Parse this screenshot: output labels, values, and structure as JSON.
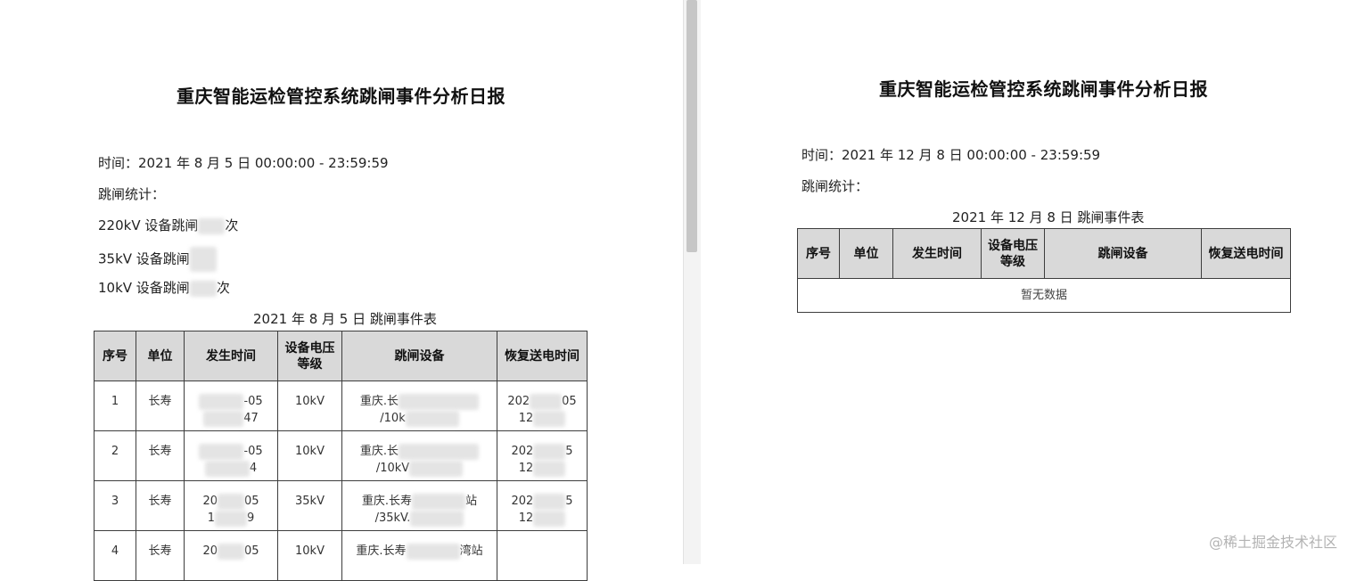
{
  "left": {
    "title": "重庆智能运检管控系统跳闸事件分析日报",
    "time_line": "时间：2021 年 8 月 5 日 00:00:00 - 23:59:59",
    "stats_heading": "跳闸统计：",
    "stats": [
      "220kV 设备跳闸",
      "35kV 设备跳闸",
      "10kV 设备跳闸"
    ],
    "stats_suffix": [
      "次",
      "",
      "次"
    ],
    "table_caption": "2021 年 8 月 5 日 跳闸事件表",
    "headers": [
      "序号",
      "单位",
      "发生时间",
      "设备电压等级",
      "跳闸设备",
      "恢复送电时间"
    ],
    "rows": [
      {
        "no": "1",
        "unit": "长寿",
        "time_a": "-05",
        "time_b": "47",
        "voltage": "10kV",
        "device_a": "重庆.长",
        "device_b": "/10k",
        "restore_a": "202",
        "restore_a2": "05",
        "restore_b": "12"
      },
      {
        "no": "2",
        "unit": "长寿",
        "time_a": "-05",
        "time_b": "4",
        "voltage": "10kV",
        "device_a": "重庆.长",
        "device_b": "/10kV",
        "restore_a": "202",
        "restore_a2": "5",
        "restore_b": "12"
      },
      {
        "no": "3",
        "unit": "长寿",
        "time_a": "20",
        "time_a2": "05",
        "time_b": "1",
        "time_b2": "9",
        "voltage": "35kV",
        "device_a": "重庆.长寿",
        "device_a2": "站",
        "device_b": "/35kV.",
        "restore_a": "202",
        "restore_a2": "5",
        "restore_b": "12"
      },
      {
        "no": "4",
        "unit": "长寿",
        "time_a": "20",
        "time_a2": "05",
        "voltage": "10kV",
        "device_a": "重庆.长寿",
        "device_a2": "湾站"
      }
    ]
  },
  "right": {
    "title": "重庆智能运检管控系统跳闸事件分析日报",
    "time_line": "时间：2021 年 12 月 8 日 00:00:00 - 23:59:59",
    "stats_heading": "跳闸统计：",
    "table_caption": "2021 年 12 月 8 日 跳闸事件表",
    "headers": [
      "序号",
      "单位",
      "发生时间",
      "设备电压等级",
      "跳闸设备",
      "恢复送电时间"
    ],
    "empty_text": "暂无数据"
  },
  "watermark": "@稀土掘金技术社区"
}
